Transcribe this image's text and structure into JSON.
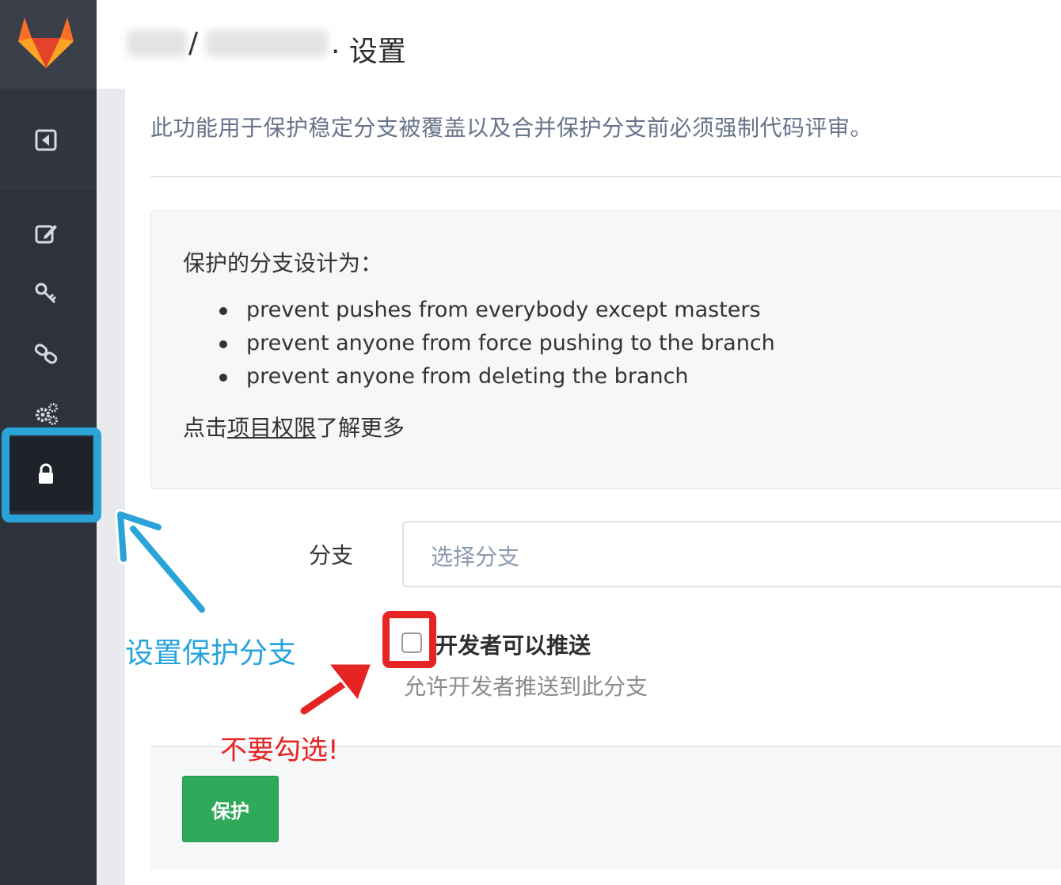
{
  "header": {
    "separator": "/",
    "title": "· 设置"
  },
  "intro": "此功能用于保护稳定分支被覆盖以及合并保护分支前必须强制代码评审。",
  "info": {
    "heading": "保护的分支设计为：",
    "items": [
      "prevent pushes from everybody except masters",
      "prevent anyone from force pushing to the branch",
      "prevent anyone from deleting the branch"
    ],
    "more_prefix": "点击",
    "more_link": "项目权限",
    "more_suffix": "了解更多"
  },
  "form": {
    "branch_label": "分支",
    "branch_placeholder": "选择分支",
    "dev_push_label": "开发者可以推送",
    "dev_push_checked": false,
    "dev_push_help": "允许开发者推送到此分支",
    "submit_label": "保护"
  },
  "annotations": {
    "sidebar_note": "设置保护分支",
    "checkbox_note": "不要勾选!"
  },
  "colors": {
    "sidebar": "#2d323d",
    "accent_green": "#2faa5b",
    "annotation_blue": "#2aa4d8",
    "annotation_red": "#e62424"
  },
  "icons": [
    "gitlab-logo",
    "collapse-icon",
    "edit-icon",
    "key-icon",
    "link-icon",
    "gears-icon",
    "lock-icon"
  ]
}
